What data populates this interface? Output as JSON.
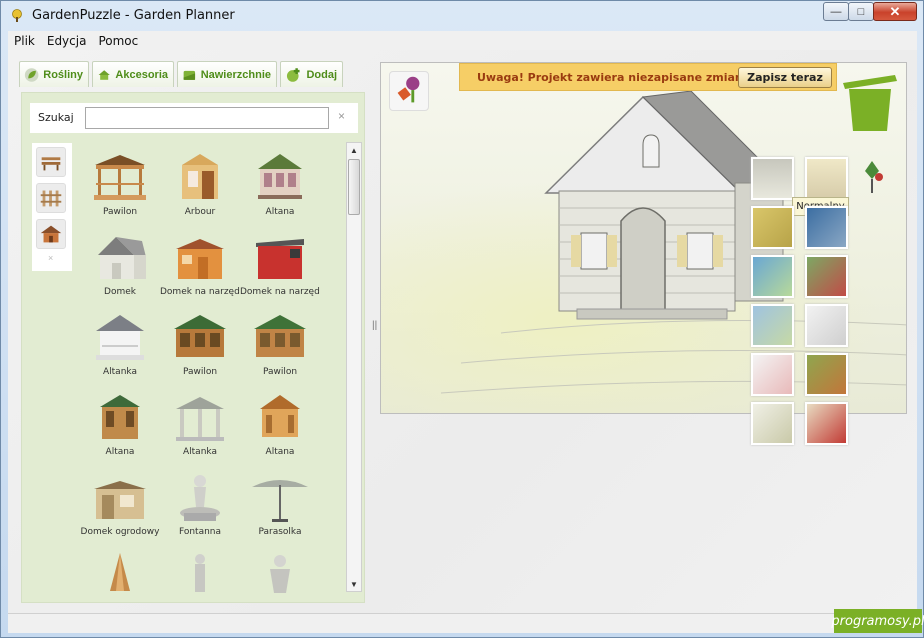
{
  "window": {
    "title": "GardenPuzzle - Garden Planner",
    "minimize": "—",
    "maximize": "□",
    "close": "✕"
  },
  "menu": [
    "Plik",
    "Edycja",
    "Pomoc"
  ],
  "tabs": [
    {
      "label": "Rośliny",
      "icon": "leaf-icon"
    },
    {
      "label": "Akcesoria",
      "icon": "house-icon"
    },
    {
      "label": "Nawierzchnie",
      "icon": "surface-icon"
    },
    {
      "label": "Dodaj",
      "icon": "add-plant-icon"
    }
  ],
  "search": {
    "label": "Szukaj",
    "value": "",
    "clear": "×"
  },
  "categories": {
    "clear": "×",
    "items": [
      "bench-icon",
      "fence-icon",
      "shed-icon"
    ]
  },
  "items": [
    {
      "label": "Pawilon"
    },
    {
      "label": "Arbour"
    },
    {
      "label": "Altana"
    },
    {
      "label": "Domek"
    },
    {
      "label": "Domek na narzędzia"
    },
    {
      "label": "Domek na narzędzia"
    },
    {
      "label": "Altanka"
    },
    {
      "label": "Pawilon"
    },
    {
      "label": "Pawilon"
    },
    {
      "label": "Altana"
    },
    {
      "label": "Altanka"
    },
    {
      "label": "Altana"
    },
    {
      "label": "Domek ogrodowy"
    },
    {
      "label": "Fontanna"
    },
    {
      "label": "Parasolka"
    },
    {
      "label": ""
    },
    {
      "label": ""
    },
    {
      "label": ""
    }
  ],
  "scroll": {
    "up": "▲",
    "down": "▼"
  },
  "splitter": "||",
  "warning": {
    "text": "Uwaga! Projekt zawiera niezapisane zmiany",
    "button": "Zapisz teraz"
  },
  "tooltip": "Normalny",
  "watermark": "programosy.pl",
  "colors": {
    "accent": "#7bb026",
    "warning_bg": "#f6ce66",
    "warning_text": "#9a3b10",
    "panel_bg": "#e2ecd2"
  }
}
